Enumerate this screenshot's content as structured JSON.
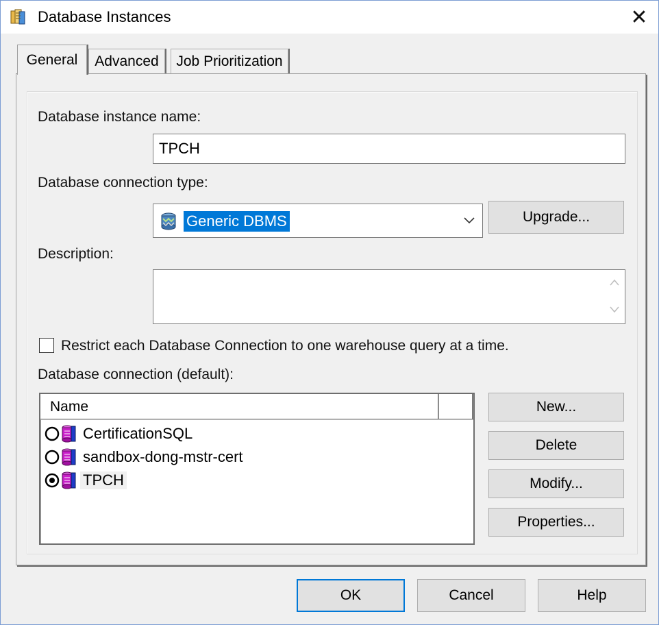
{
  "window": {
    "title": "Database Instances",
    "close_glyph": "✕",
    "title_icon": "database-instances-icon"
  },
  "tabs": [
    {
      "label": "General",
      "active": true
    },
    {
      "label": "Advanced",
      "active": false
    },
    {
      "label": "Job Prioritization",
      "active": false
    }
  ],
  "general": {
    "instance_name_label": "Database instance name:",
    "instance_name_value": "TPCH",
    "connection_type_label": "Database connection type:",
    "connection_type_value": "Generic DBMS",
    "upgrade_label": "Upgrade...",
    "description_label": "Description:",
    "description_value": "",
    "restrict_label": "Restrict each Database Connection to one warehouse query at a time.",
    "restrict_checked": false,
    "connection_default_label": "Database connection (default):",
    "list_header_name": "Name",
    "connections": [
      {
        "name": "CertificationSQL",
        "selected": false
      },
      {
        "name": "sandbox-dong-mstr-cert",
        "selected": false
      },
      {
        "name": "TPCH",
        "selected": true
      }
    ],
    "side_buttons": {
      "new": "New...",
      "delete": "Delete",
      "modify": "Modify...",
      "properties": "Properties..."
    }
  },
  "footer": {
    "ok": "OK",
    "cancel": "Cancel",
    "help": "Help"
  },
  "colors": {
    "selection": "#0078d7",
    "db_icon_magenta": "#c81ec8",
    "db_icon_blue": "#1e3cc8"
  }
}
